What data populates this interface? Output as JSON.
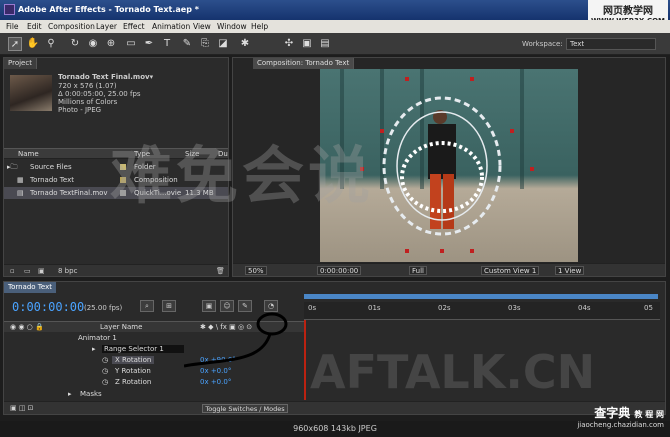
{
  "app": {
    "title": "Adobe After Effects - Tornado Text.aep *",
    "watermark_top": "网页教学网",
    "watermark_top_url": "WWW.WEB3X.COM"
  },
  "menu": [
    "File",
    "Edit",
    "Composition",
    "Layer",
    "Effect",
    "Animation",
    "View",
    "Window",
    "Help"
  ],
  "toolbar": {
    "tools": [
      "selection-tool",
      "hand-tool",
      "zoom-tool",
      "rotate-tool",
      "camera-tool",
      "pan-behind-tool",
      "pen-tool",
      "type-tool",
      "brush-tool",
      "clone-tool",
      "eraser-tool",
      "puppet-tool"
    ],
    "workspace_label": "Workspace:",
    "workspace_value": "Text"
  },
  "project": {
    "tab": "Project",
    "file_name": "Tornado Text Final.mov▾",
    "file_info": [
      "720 x 576 (1.07)",
      "Δ 0:00:05:00, 25.00 fps",
      "Millions of Colors",
      "Photo - JPEG"
    ],
    "columns": [
      "Name",
      "Type",
      "Size",
      "Du"
    ],
    "rows": [
      {
        "name": "Source Files",
        "type": "Folder",
        "size": "",
        "color": "#c7b873"
      },
      {
        "name": "Tornado Text",
        "type": "Composition",
        "size": "",
        "color": "#b7a35a"
      },
      {
        "name": "Tornado TextFinal.mov",
        "type": "QuickTi...ovie",
        "size": "11.3 MB",
        "color": "#9e9e9e"
      }
    ],
    "bpc": "8 bpc"
  },
  "composition": {
    "tab": "Composition: Tornado Text",
    "zoom": "50%",
    "timecode": "0:00:00:00",
    "resolution": "Full",
    "view": "Custom View 1",
    "views": "1 View"
  },
  "timeline": {
    "tab": "Tornado Text",
    "timecode": "0:00:00:00",
    "fps": "(25.00 fps)",
    "ruler_ticks": [
      "0s",
      "01s",
      "02s",
      "03s",
      "04s",
      "05"
    ],
    "layer_col": "Layer Name",
    "rows": [
      {
        "label": "Animator 1",
        "value": ""
      },
      {
        "label": "Range Selector 1",
        "value": ""
      },
      {
        "label": "X Rotation",
        "value": "0x +90.0°"
      },
      {
        "label": "Y Rotation",
        "value": "0x +0.0°"
      },
      {
        "label": "Z Rotation",
        "value": "0x +0.0°"
      },
      {
        "label": "Masks",
        "value": ""
      }
    ],
    "toggle": "Toggle Switches / Modes"
  },
  "overlays": {
    "cn_watermark": "难免会说",
    "aftalk": "AFTALK.CN",
    "chazidian": "查字典",
    "chazidian_sub": "教 程 网",
    "chazidian_url": "jiaocheng.chazidian.com"
  },
  "status": "960x608  143kb  JPEG"
}
